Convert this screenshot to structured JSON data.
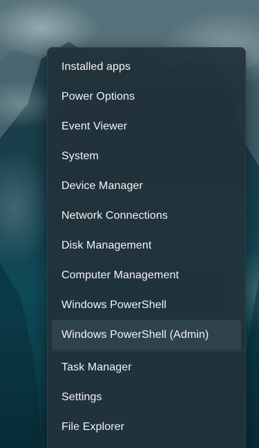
{
  "menu": {
    "group1": [
      {
        "label": "Installed apps"
      },
      {
        "label": "Power Options"
      },
      {
        "label": "Event Viewer"
      },
      {
        "label": "System"
      },
      {
        "label": "Device Manager"
      },
      {
        "label": "Network Connections"
      },
      {
        "label": "Disk Management"
      },
      {
        "label": "Computer Management"
      },
      {
        "label": "Windows PowerShell"
      },
      {
        "label": "Windows PowerShell (Admin)"
      }
    ],
    "group2": [
      {
        "label": "Task Manager"
      },
      {
        "label": "Settings"
      },
      {
        "label": "File Explorer"
      }
    ],
    "selected_item": "Windows PowerShell (Admin)"
  }
}
